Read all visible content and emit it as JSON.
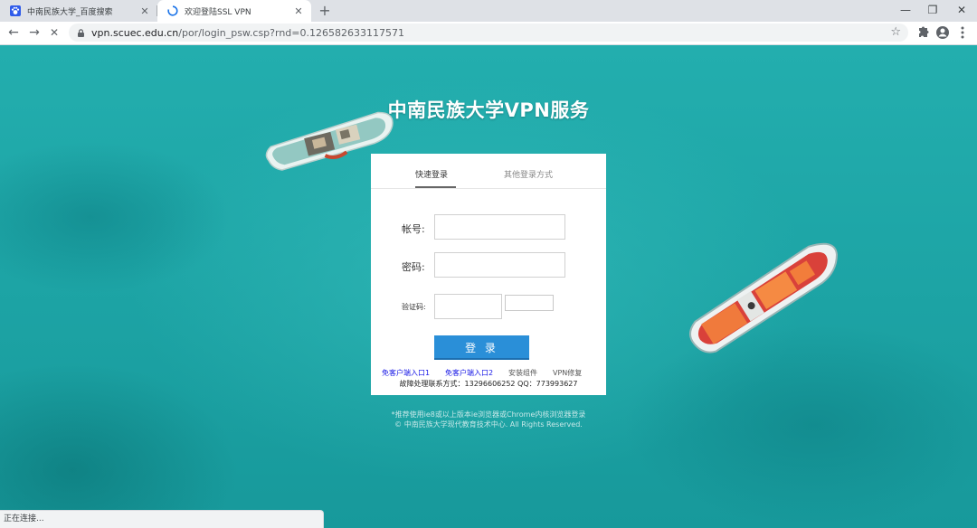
{
  "browser": {
    "tabs": [
      {
        "title": "中南民族大学_百度搜索",
        "close": "✕",
        "icon": "baidu-paw-icon"
      },
      {
        "title": "欢迎登陆SSL VPN",
        "close": "✕",
        "icon": "loading-spinner-icon"
      }
    ],
    "new_tab": "+",
    "window_controls": {
      "minimize": "—",
      "restore": "❐",
      "close": "✕"
    },
    "nav": {
      "back": "←",
      "forward": "→",
      "stop": "✕"
    },
    "url_host": "vpn.scuec.edu.cn",
    "url_path": "/por/login_psw.csp?rnd=0.126582633117571",
    "bookmark_star": "☆"
  },
  "page": {
    "title": "中南民族大学VPN服务",
    "login_tabs": {
      "quick": "快速登录",
      "other": "其他登录方式"
    },
    "form": {
      "account_label": "帐号:",
      "account_value": "",
      "password_label": "密码:",
      "password_value": "",
      "captcha_label": "验证码:",
      "captcha_value": "",
      "submit": "登 录"
    },
    "links": {
      "clientless1": "免客户端入口1",
      "clientless2": "免客户端入口2",
      "install": "安装组件",
      "repair": "VPN修复"
    },
    "contact": "故障处理联系方式：13296606252 QQ：773993627",
    "footer_line1": "*推荐使用ie8或以上版本ie浏览器或Chrome内核浏览器登录",
    "footer_line2": "© 中南民族大学现代教育技术中心. All Rights Reserved."
  },
  "status_bar": "正在连接..."
}
